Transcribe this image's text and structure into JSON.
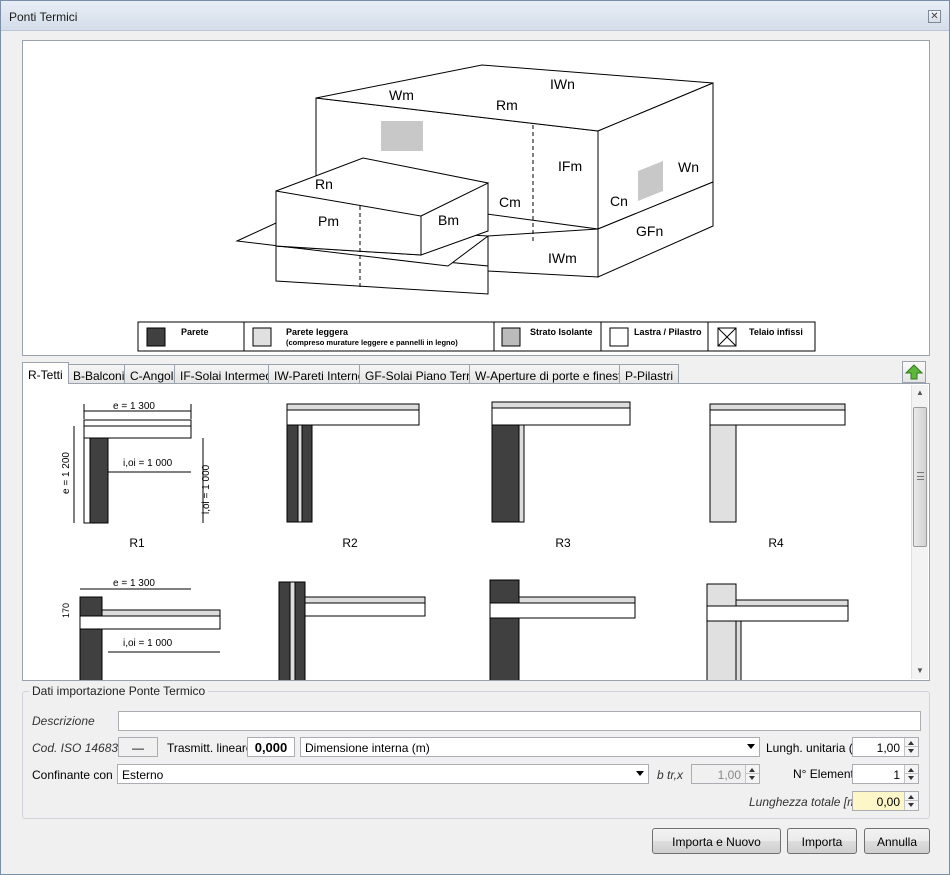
{
  "window": {
    "title": "Ponti Termici",
    "close_icon": "close-icon"
  },
  "diagram": {
    "labels": [
      "Wm",
      "Rm",
      "IWn",
      "IFm",
      "Wn",
      "Rn",
      "Cm",
      "Cn",
      "Pm",
      "Bm",
      "GFn",
      "IWm"
    ],
    "legend": {
      "parete": "Parete",
      "parete_leggera": "Parete leggera",
      "parete_leggera_note": "(compreso murature leggere e pannelli in legno)",
      "strato_isolante": "Strato Isolante",
      "lastra_pilastro": "Lastra / Pilastro",
      "telaio_infissi": "Telaio infissi"
    }
  },
  "tabs": [
    {
      "label": "R-Tetti",
      "active": true
    },
    {
      "label": "B-Balconi"
    },
    {
      "label": "C-Angoli"
    },
    {
      "label": "IF-Solai Intermedi"
    },
    {
      "label": "IW-Pareti Interne"
    },
    {
      "label": "GF-Solai Piano Terra"
    },
    {
      "label": "W-Aperture di porte e finestre"
    },
    {
      "label": "P-Pilastri"
    }
  ],
  "gallery": {
    "captions": [
      "R1",
      "R2",
      "R3",
      "R4"
    ],
    "dims": {
      "e_h": "e = 1 300",
      "e_v": "e = 1 200",
      "ioi_h": "i,oi = 1 000",
      "ioi_v": "i,oi = 1 000",
      "d170": "170"
    }
  },
  "form": {
    "group_title": "Dati importazione Ponte Termico",
    "descrizione_label": "Descrizione",
    "descrizione_value": "",
    "cod_label": "Cod. ISO 14683",
    "cod_value": "—",
    "trasmitt_label": "Trasmitt. lineare",
    "trasmitt_value": "0,000",
    "dimensione_value": "Dimensione interna (m)",
    "lungh_label": "Lungh. unitaria (m)",
    "lungh_value": "1,00",
    "confinante_label": "Confinante con",
    "confinante_value": "Esterno",
    "btrx_label": "b tr,x",
    "btrx_value": "1,00",
    "nelementi_label": "N° Elementi",
    "nelementi_value": "1",
    "lungh_totale_label": "Lunghezza totale [m]",
    "lungh_totale_value": "0,00"
  },
  "buttons": {
    "importa_nuovo": "Importa e Nuovo",
    "importa": "Importa",
    "annulla": "Annulla"
  }
}
